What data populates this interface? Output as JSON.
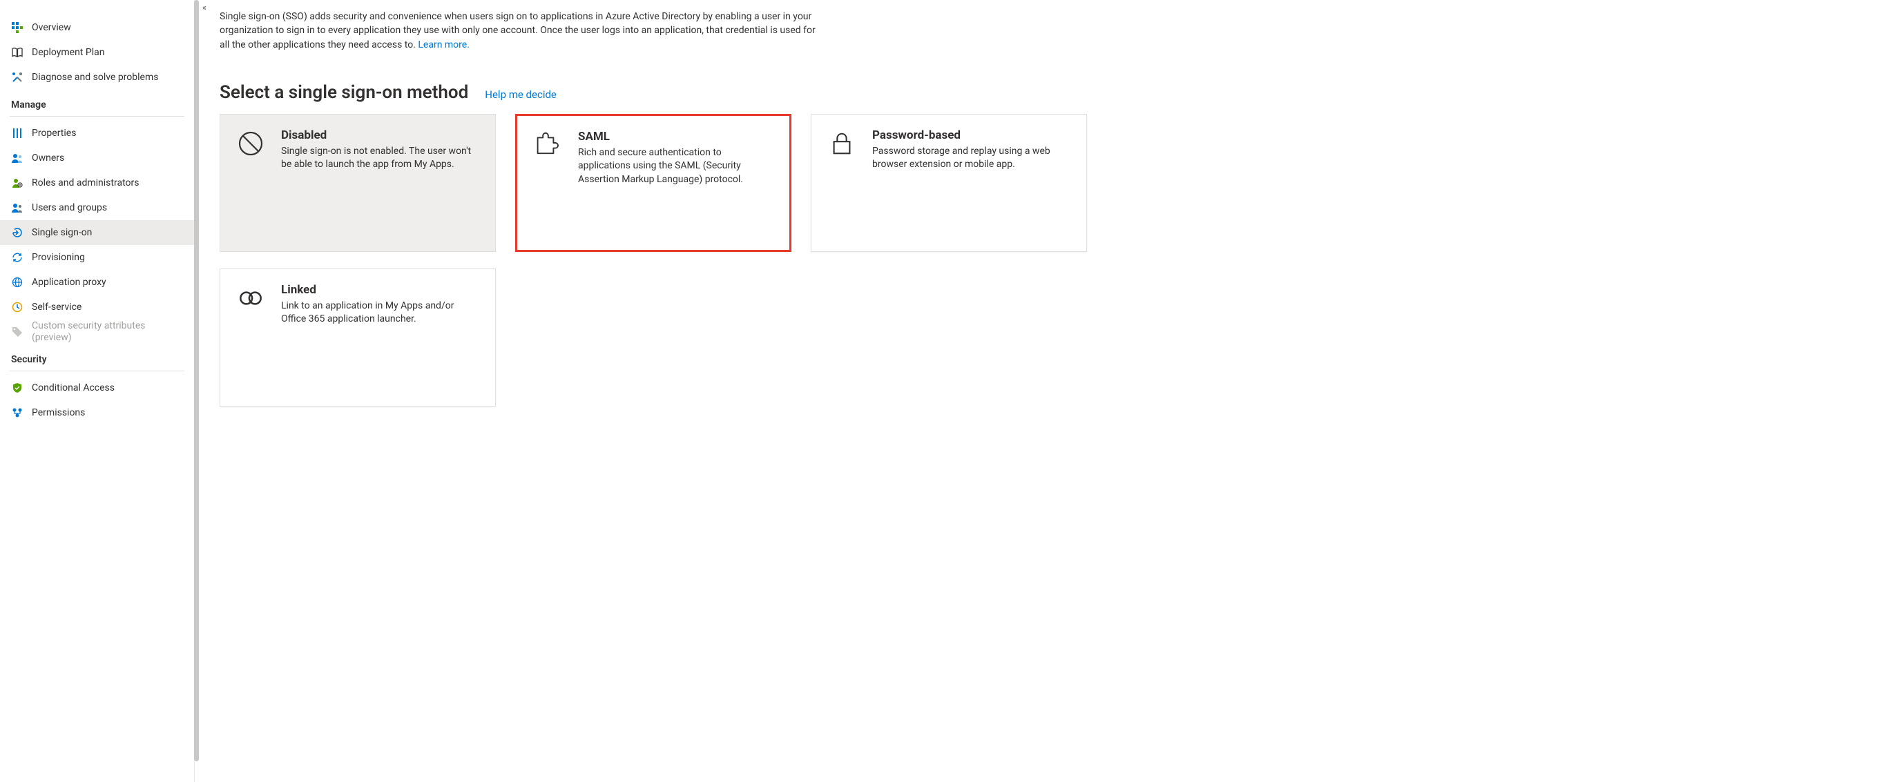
{
  "sidebar": {
    "collapse_glyph": "«",
    "top": [
      {
        "label": "Overview"
      },
      {
        "label": "Deployment Plan"
      },
      {
        "label": "Diagnose and solve problems"
      }
    ],
    "manage_header": "Manage",
    "manage": [
      {
        "label": "Properties"
      },
      {
        "label": "Owners"
      },
      {
        "label": "Roles and administrators"
      },
      {
        "label": "Users and groups"
      },
      {
        "label": "Single sign-on"
      },
      {
        "label": "Provisioning"
      },
      {
        "label": "Application proxy"
      },
      {
        "label": "Self-service"
      },
      {
        "label": "Custom security attributes (preview)"
      }
    ],
    "security_header": "Security",
    "security": [
      {
        "label": "Conditional Access"
      },
      {
        "label": "Permissions"
      }
    ]
  },
  "intro": {
    "text": "Single sign-on (SSO) adds security and convenience when users sign on to applications in Azure Active Directory by enabling a user in your organization to sign in to every application they use with only one account. Once the user logs into an application, that credential is used for all the other applications they need access to. ",
    "learn_more": "Learn more."
  },
  "section": {
    "title": "Select a single sign-on method",
    "help_link": "Help me decide"
  },
  "cards": {
    "disabled": {
      "title": "Disabled",
      "desc": "Single sign-on is not enabled. The user won't be able to launch the app from My Apps."
    },
    "saml": {
      "title": "SAML",
      "desc": "Rich and secure authentication to applications using the SAML (Security Assertion Markup Language) protocol."
    },
    "password": {
      "title": "Password-based",
      "desc": "Password storage and replay using a web browser extension or mobile app."
    },
    "linked": {
      "title": "Linked",
      "desc": "Link to an application in My Apps and/or Office 365 application launcher."
    }
  }
}
